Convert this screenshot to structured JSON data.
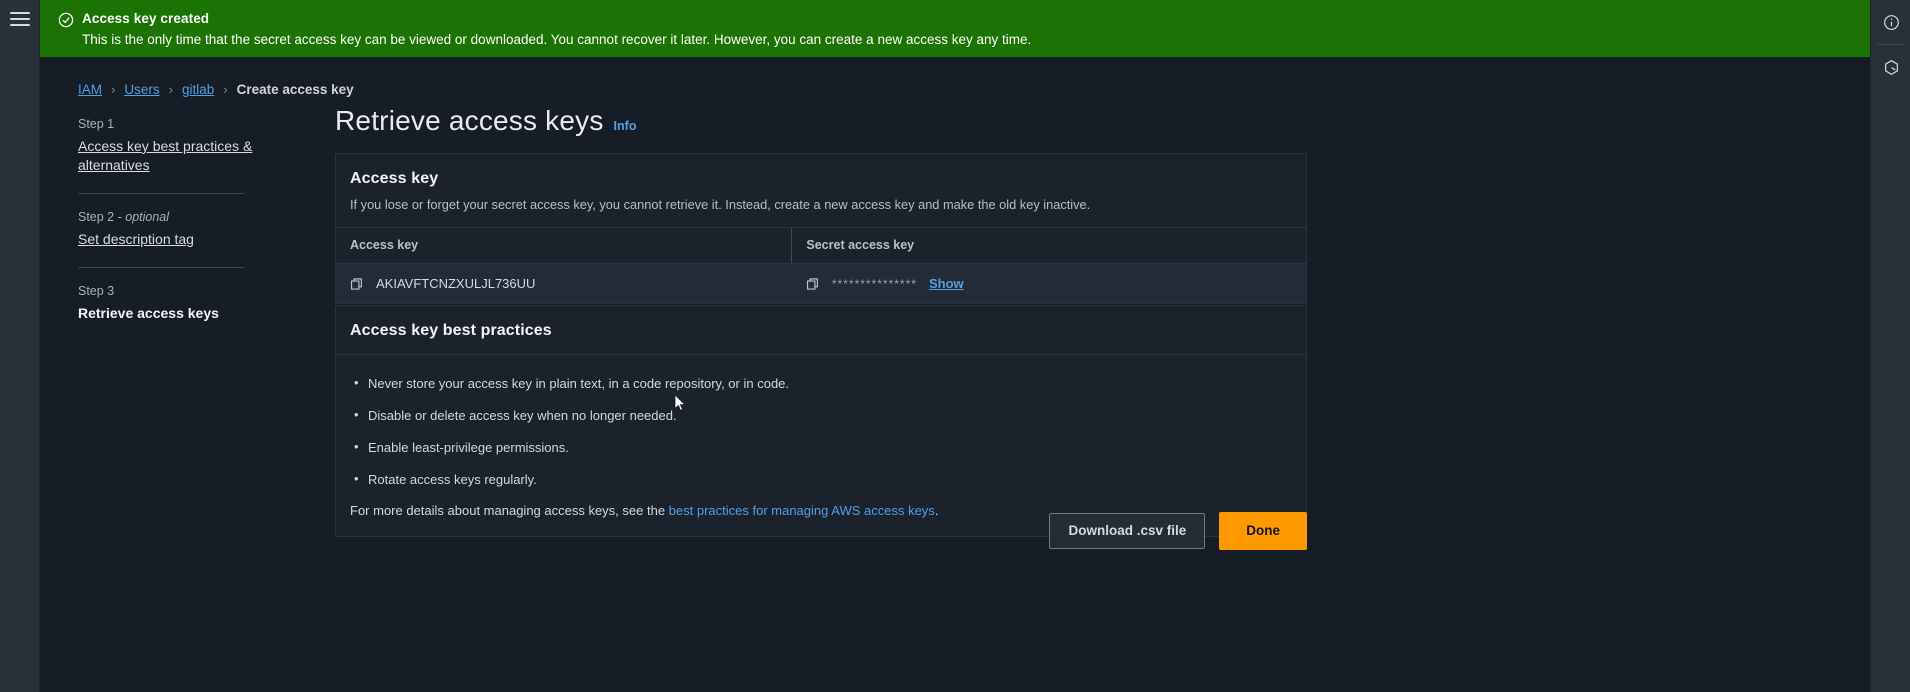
{
  "flash": {
    "title": "Access key created",
    "message": "This is the only time that the secret access key can be viewed or downloaded. You cannot recover it later. However, you can create a new access key any time.",
    "icon": "check-circle-icon",
    "color": "#1a7302"
  },
  "left_rail": {
    "menu_icon": "hamburger-menu-icon"
  },
  "right_rail": {
    "items": [
      {
        "icon": "info-circle-icon"
      },
      {
        "icon": "settings-gear-icon"
      }
    ]
  },
  "breadcrumb": {
    "items": [
      {
        "label": "IAM",
        "current": false
      },
      {
        "label": "Users",
        "current": false
      },
      {
        "label": "gitlab",
        "current": false
      },
      {
        "label": "Create access key",
        "current": true
      }
    ],
    "separator": "›"
  },
  "steps": [
    {
      "number": "Step 1",
      "label": "Access key best practices & alternatives",
      "current": false
    },
    {
      "number": "Step 2 - ",
      "optional": "optional",
      "label": "Set description tag",
      "current": false
    },
    {
      "number": "Step 3",
      "label": "Retrieve access keys",
      "current": true
    }
  ],
  "page": {
    "title": "Retrieve access keys",
    "info_label": "Info"
  },
  "access_key_card": {
    "title": "Access key",
    "description": "If you lose or forget your secret access key, you cannot retrieve it. Instead, create a new access key and make the old key inactive.",
    "columns": [
      "Access key",
      "Secret access key"
    ],
    "access_key_value": "AKIAVFTCNZXULJL736UU",
    "secret_masked": "***************",
    "show_label": "Show",
    "copy_icon": "copy-icon"
  },
  "best_practices_card": {
    "title": "Access key best practices",
    "items": [
      "Never store your access key in plain text, in a code repository, or in code.",
      "Disable or delete access key when no longer needed.",
      "Enable least-privilege permissions.",
      "Rotate access keys regularly."
    ],
    "footnote_prefix": "For more details about managing access keys, see the ",
    "footnote_link": "best practices for managing AWS access keys",
    "footnote_suffix": "."
  },
  "footer": {
    "download_label": "Download .csv file",
    "done_label": "Done",
    "primary_color": "#ff9900"
  }
}
